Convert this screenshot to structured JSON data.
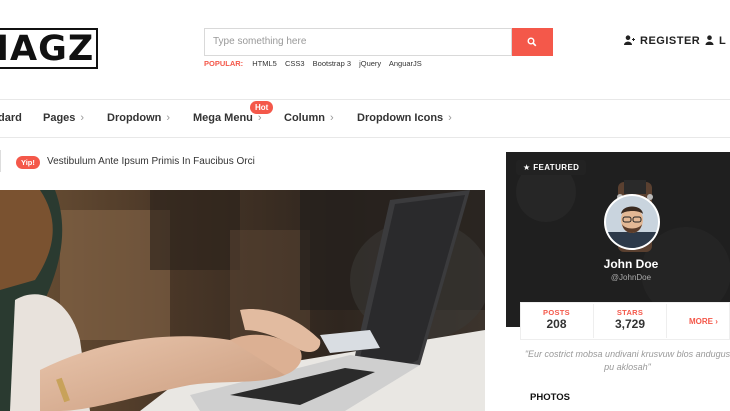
{
  "logo": {
    "text": "IAGZ"
  },
  "search": {
    "placeholder": "Type something here",
    "popular_label": "POPULAR:",
    "popular_tags": [
      "HTML5",
      "CSS3",
      "Bootstrap 3",
      "jQuery",
      "AnguarJS"
    ]
  },
  "account": {
    "register_label": "REGISTER",
    "login_label": "L"
  },
  "nav": {
    "items": [
      {
        "label": "dard",
        "has_chevron": false
      },
      {
        "label": "Pages",
        "has_chevron": true
      },
      {
        "label": "Dropdown",
        "has_chevron": true
      },
      {
        "label": "Mega Menu",
        "has_chevron": true
      },
      {
        "label": "Column",
        "has_chevron": true
      },
      {
        "label": "Dropdown Icons",
        "has_chevron": true
      }
    ],
    "hot_badge": "Hot"
  },
  "ticker": {
    "badge": "Yip!",
    "text": "Vestibulum Ante Ipsum Primis In Faucibus Orci"
  },
  "hero": {
    "icon": "laptop-typing-photo"
  },
  "profile": {
    "featured_label": "FEATURED",
    "name": "John Doe",
    "handle": "@JohnDoe",
    "stats": [
      {
        "label": "POSTS",
        "value": "208"
      },
      {
        "label": "STARS",
        "value": "3,729"
      }
    ],
    "more_label": "MORE",
    "quote": "\"Eur costrict mobsa undivani krusvuw blos andugus pu aklosah\"",
    "photos_heading": "PHOTOS"
  },
  "colors": {
    "accent": "#f4584a",
    "dark": "#1e1e1e"
  }
}
